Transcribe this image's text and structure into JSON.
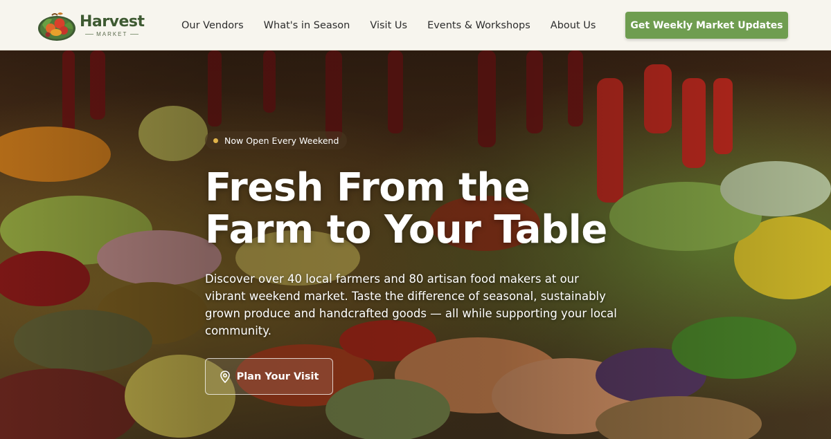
{
  "brand": {
    "name": "Harvest",
    "sub": "MARKET",
    "logo_icon": "produce-basket-logo"
  },
  "nav": {
    "items": [
      {
        "label": "Our Vendors"
      },
      {
        "label": "What's in Season"
      },
      {
        "label": "Visit Us"
      },
      {
        "label": "Events & Workshops"
      },
      {
        "label": "About Us"
      }
    ]
  },
  "header": {
    "cta_label": "Get Weekly Market Updates"
  },
  "hero": {
    "badge": "Now Open Every Weekend",
    "title_line1": "Fresh From the",
    "title_line2": "Farm to Your Table",
    "description": "Discover over 40 local farmers and 80 artisan food makers at our vibrant weekend market. Taste the difference of seasonal, sustainably grown produce and handcrafted goods — all while supporting your local community.",
    "button_label": "Plan Your Visit",
    "button_icon": "map-pin-icon",
    "background": "market-produce-photo"
  },
  "colors": {
    "accent_green": "#6f9d50",
    "header_bg": "#f7f5ee",
    "brand_green": "#3e5a32",
    "badge_dot": "#e0b34a"
  }
}
